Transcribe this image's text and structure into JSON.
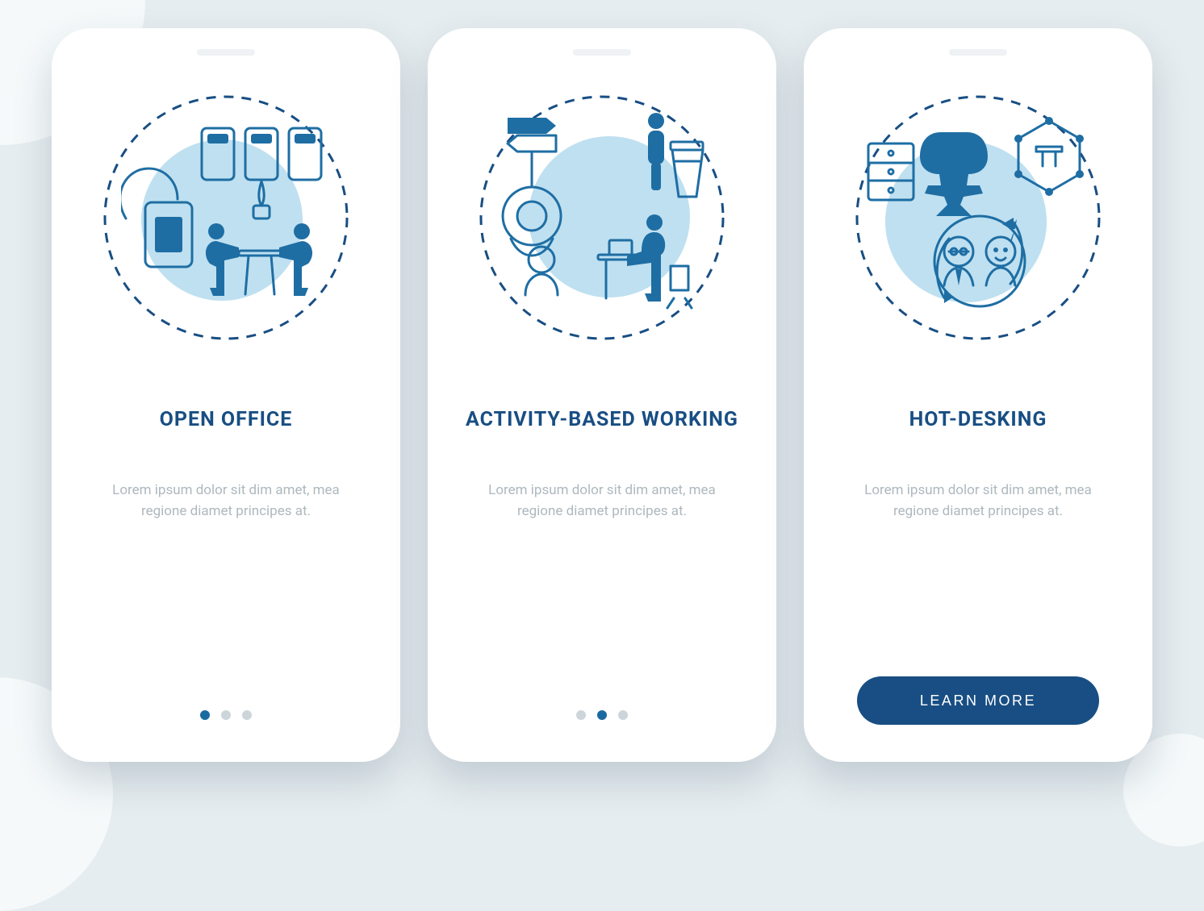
{
  "colors": {
    "primary_dark": "#184e83",
    "primary_mid": "#1e6ea4",
    "accent_light": "#bfe0f0",
    "text_muted": "#aeb8be"
  },
  "screens": [
    {
      "icon": "open-office-icon",
      "title": "OPEN OFFICE",
      "description": "Lorem ipsum dolor sit dim amet, mea regione diamet principes at.",
      "nav": "dots",
      "activeDot": 0
    },
    {
      "icon": "activity-based-working-icon",
      "title": "ACTIVITY-BASED WORKING",
      "description": "Lorem ipsum dolor sit dim amet, mea regione diamet principes at.",
      "nav": "dots",
      "activeDot": 1
    },
    {
      "icon": "hot-desking-icon",
      "title": "HOT-DESKING",
      "description": "Lorem ipsum dolor sit dim amet, mea regione diamet principes at.",
      "nav": "button",
      "button_label": "LEARN MORE"
    }
  ]
}
